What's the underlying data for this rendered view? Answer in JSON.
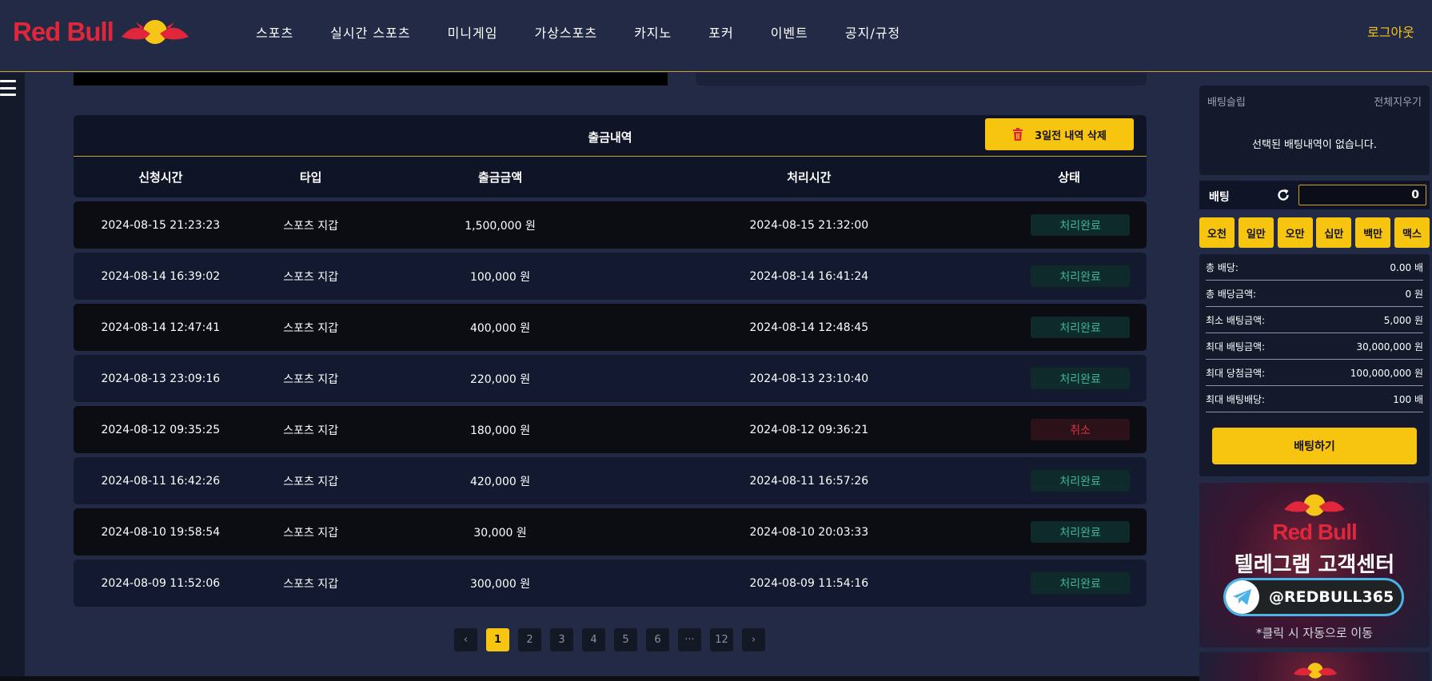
{
  "brand": {
    "logo_text": "Red Bull"
  },
  "nav": {
    "items": [
      "스포츠",
      "실시간 스포츠",
      "미니게임",
      "가상스포츠",
      "카지노",
      "포커",
      "이벤트",
      "공지/규정"
    ],
    "logout": "로그아웃"
  },
  "withdrawals": {
    "title": "출금내역",
    "delete_label": "3일전 내역 삭제",
    "columns": [
      "신청시간",
      "타입",
      "출금금액",
      "처리시간",
      "상태"
    ],
    "rows": [
      {
        "requested": "2024-08-15 21:23:23",
        "type": "스포츠 지갑",
        "amount": "1,500,000 원",
        "processed": "2024-08-15 21:32:00",
        "status": "처리완료"
      },
      {
        "requested": "2024-08-14 16:39:02",
        "type": "스포츠 지갑",
        "amount": "100,000 원",
        "processed": "2024-08-14 16:41:24",
        "status": "처리완료"
      },
      {
        "requested": "2024-08-14 12:47:41",
        "type": "스포츠 지갑",
        "amount": "400,000 원",
        "processed": "2024-08-14 12:48:45",
        "status": "처리완료"
      },
      {
        "requested": "2024-08-13 23:09:16",
        "type": "스포츠 지갑",
        "amount": "220,000 원",
        "processed": "2024-08-13 23:10:40",
        "status": "처리완료"
      },
      {
        "requested": "2024-08-12 09:35:25",
        "type": "스포츠 지갑",
        "amount": "180,000 원",
        "processed": "2024-08-12 09:36:21",
        "status": "취소"
      },
      {
        "requested": "2024-08-11 16:42:26",
        "type": "스포츠 지갑",
        "amount": "420,000 원",
        "processed": "2024-08-11 16:57:26",
        "status": "처리완료"
      },
      {
        "requested": "2024-08-10 19:58:54",
        "type": "스포츠 지갑",
        "amount": "30,000 원",
        "processed": "2024-08-10 20:03:33",
        "status": "처리완료"
      },
      {
        "requested": "2024-08-09 11:52:06",
        "type": "스포츠 지갑",
        "amount": "300,000 원",
        "processed": "2024-08-09 11:54:16",
        "status": "처리완료"
      }
    ]
  },
  "pagination": {
    "prev": "‹",
    "pages": [
      "1",
      "2",
      "3",
      "4",
      "5",
      "6",
      "···",
      "12"
    ],
    "next": "›",
    "current": "1"
  },
  "bet_slip": {
    "title": "배팅슬립",
    "clear_all": "전체지우기",
    "empty_message": "선택된 배팅내역이 없습니다.",
    "bet_label": "배팅",
    "bet_amount": "0",
    "amount_buttons": [
      "오천",
      "일만",
      "오만",
      "십만",
      "백만",
      "맥스"
    ],
    "info": [
      {
        "label": "총 배당:",
        "value": "0.00 배"
      },
      {
        "label": "총 배당금액:",
        "value": "0 원"
      },
      {
        "label": "최소 배팅금액:",
        "value": "5,000 원"
      },
      {
        "label": "최대 배팅금액:",
        "value": "30,000,000 원"
      },
      {
        "label": "최대 당첨금액:",
        "value": "100,000,000 원"
      },
      {
        "label": "최대 배팅배당:",
        "value": "100 배"
      }
    ],
    "place_bet": "배팅하기"
  },
  "banner": {
    "brand": "Red Bull",
    "title": "텔레그램 고객센터",
    "handle": "@REDBULL365",
    "note": "*클릭 시 자동으로 이동"
  },
  "colors": {
    "accent": "#f7c40f",
    "background": "#232a45",
    "brand_red": "#e0263a",
    "status_ok": "#3fb59a",
    "status_cancel": "#d8363f"
  }
}
